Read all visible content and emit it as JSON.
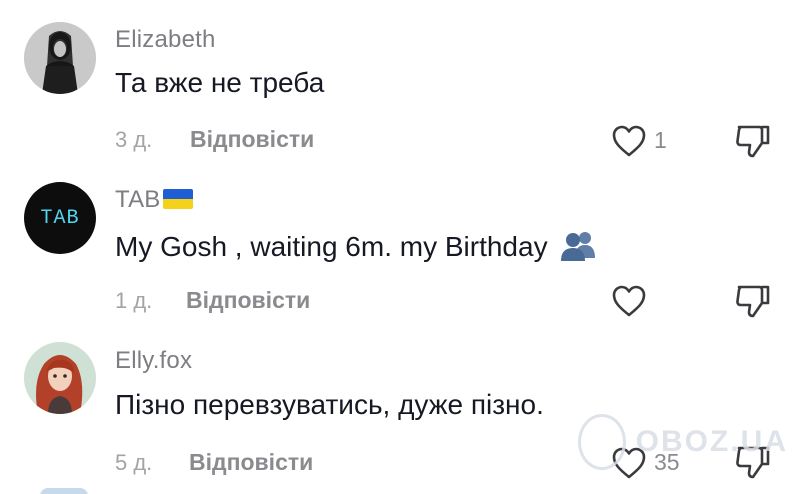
{
  "comments": [
    {
      "username": "Elizabeth",
      "text": "Та вже не треба",
      "time": "3 д.",
      "reply_label": "Відповісти",
      "likes": "1"
    },
    {
      "username": "TAB",
      "avatar_text": "TAB",
      "text": "My Gosh , waiting 6m. my Birthday",
      "time": "1 д.",
      "reply_label": "Відповісти",
      "likes": ""
    },
    {
      "username": "Elly.fox",
      "text": "Пізно перевзуватись, дуже пізно.",
      "time": "5 д.",
      "reply_label": "Відповісти",
      "likes": "35"
    }
  ],
  "watermark": "OBOZ.UA",
  "colors": {
    "username": "#7d7d82",
    "text": "#161823",
    "meta": "#a3a3a8",
    "icon": "#3a3a3f",
    "flag_blue": "#1f5fd6",
    "flag_yellow": "#f5d21a"
  },
  "icons": {
    "like": "heart-outline-icon",
    "dislike": "thumbs-down-icon",
    "flag": "ukraine-flag-icon",
    "emoji": "busts-in-silhouette-icon"
  }
}
